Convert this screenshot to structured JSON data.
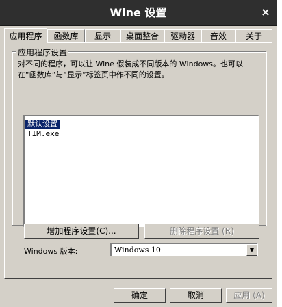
{
  "window": {
    "title": "Wine 设置",
    "close_glyph": "×"
  },
  "tabs": [
    {
      "label": "应用程序"
    },
    {
      "label": "函数库"
    },
    {
      "label": "显示"
    },
    {
      "label": "桌面整合"
    },
    {
      "label": "驱动器"
    },
    {
      "label": "音效"
    },
    {
      "label": "关于"
    }
  ],
  "apps_group": {
    "label": "应用程序设置",
    "description": "对不同的程序，可以让 Wine 假装成不同版本的 Windows。也可以在“函数库”与“显示”标签页中作不同的设置。",
    "items": [
      "默认设置",
      "TIM.exe"
    ],
    "selected_index": 0
  },
  "buttons": {
    "add": "增加程序设置(C)...",
    "remove": "删除程序设置 (R)"
  },
  "windows_version": {
    "label": "Windows 版本:",
    "value": "Windows 10"
  },
  "footer": {
    "ok": "确定",
    "cancel": "取消",
    "apply": "应用 (A)"
  }
}
